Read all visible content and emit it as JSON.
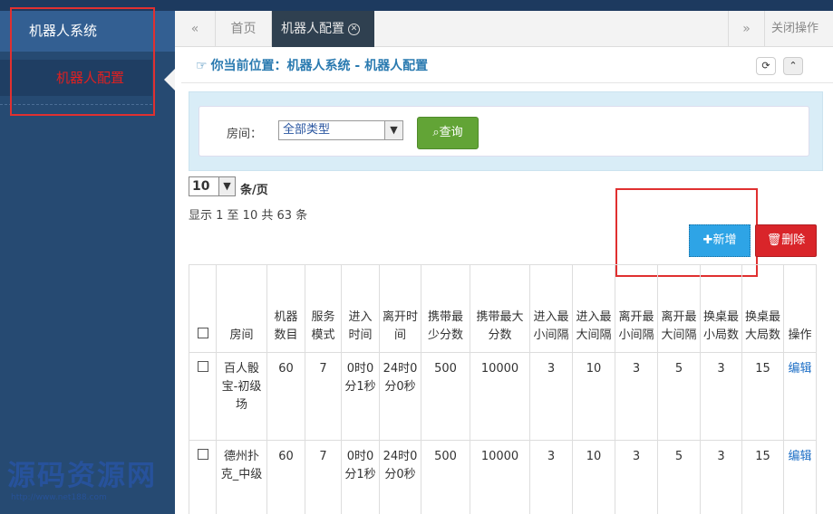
{
  "sidebar": {
    "group_label": "机器人系统",
    "item_label": "机器人配置"
  },
  "tabs": {
    "nav_left": "«",
    "home_label": "首页",
    "active_label": "机器人配置",
    "nav_right": "»",
    "close_ops_label": "关闭操作"
  },
  "breadcrumb": {
    "text": "你当前位置：机器人系统 - 机器人配置"
  },
  "search": {
    "room_label": "房间：",
    "room_selected": "全部类型",
    "query_label": "查询"
  },
  "pagination": {
    "page_size": "10",
    "per_page_label": "条/页",
    "showing_text": "显示 1 至 10 共 63 条"
  },
  "toolbar": {
    "add_label": "新增",
    "delete_label": "删除"
  },
  "table": {
    "headers": [
      "",
      "房间",
      "机器数目",
      "服务模式",
      "进入时间",
      "离开时间",
      "携带最少分数",
      "携带最大分数",
      "进入最小间隔",
      "进入最大间隔",
      "离开最小间隔",
      "离开最大间隔",
      "换桌最小局数",
      "换桌最大局数",
      "操作"
    ],
    "rows": [
      {
        "room": "百人骰宝-初级场",
        "robots": "60",
        "mode": "7",
        "enter_time": "0时0分1秒",
        "leave_time": "24时0分0秒",
        "min_score": "500",
        "max_score": "10000",
        "enter_min": "3",
        "enter_max": "10",
        "leave_min": "3",
        "leave_max": "5",
        "switch_min": "3",
        "switch_max": "15",
        "action": "编辑"
      },
      {
        "room": "德州扑克_中级",
        "robots": "60",
        "mode": "7",
        "enter_time": "0时0分1秒",
        "leave_time": "24时0分0秒",
        "min_score": "500",
        "max_score": "10000",
        "enter_min": "3",
        "enter_max": "10",
        "leave_min": "3",
        "leave_max": "5",
        "switch_min": "3",
        "switch_max": "15",
        "action": "编辑"
      }
    ]
  },
  "watermark": {
    "text": "源码资源网",
    "sub": "http://www.net188.com"
  },
  "colors": {
    "sidebar_bg": "#264a72",
    "active_tab_bg": "#2f4050",
    "add_button": "#2ea4e6",
    "delete_button": "#d9252a",
    "query_button": "#62a436",
    "highlight_box": "#e03030"
  }
}
